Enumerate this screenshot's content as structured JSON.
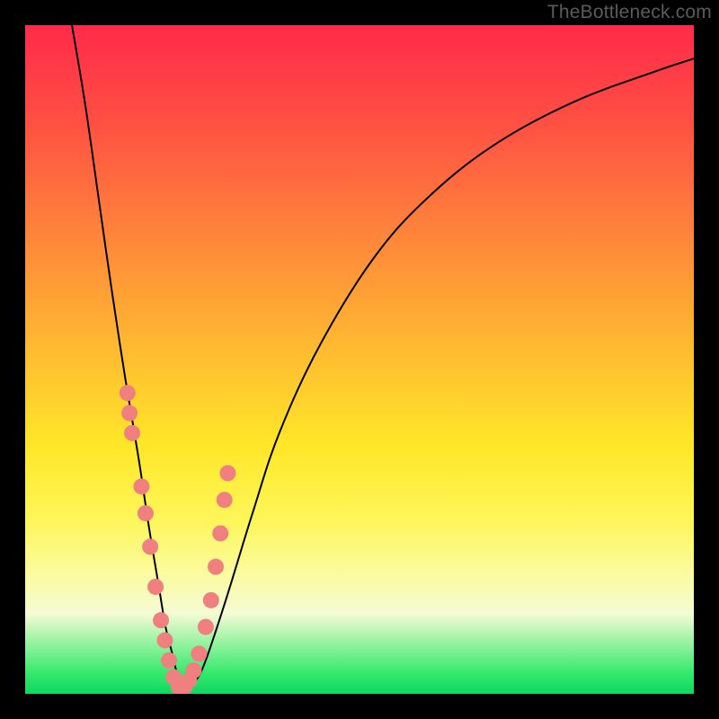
{
  "watermark": "TheBottleneck.com",
  "chart_data": {
    "type": "line",
    "title": "",
    "xlabel": "",
    "ylabel": "",
    "xlim": [
      0,
      100
    ],
    "ylim": [
      0,
      100
    ],
    "grid": false,
    "background_gradient": {
      "top": "#ff2a4a",
      "mid_upper": "#ffa030",
      "mid_lower": "#fde52a",
      "bottom": "#11d760"
    },
    "series": [
      {
        "name": "bottleneck-curve",
        "color": "#000000",
        "x": [
          7,
          9,
          11,
          13,
          15,
          17,
          18.5,
          20,
          21,
          22,
          23,
          24,
          25.5,
          27,
          30,
          34,
          38,
          44,
          52,
          60,
          70,
          82,
          94,
          100
        ],
        "y": [
          100,
          88,
          74,
          60,
          47,
          35,
          25,
          16,
          10,
          6,
          2,
          1,
          2,
          5,
          14,
          27,
          39,
          52,
          65,
          74,
          82,
          88.5,
          93,
          95
        ]
      },
      {
        "name": "highlight-markers",
        "type": "scatter",
        "color": "#f08080",
        "x": [
          15.3,
          15.6,
          16.0,
          17.4,
          18.0,
          18.7,
          19.5,
          20.3,
          20.9,
          21.5,
          22.2,
          23.0,
          23.8,
          24.5,
          25.2,
          26.0,
          27.0,
          27.8,
          28.5,
          29.2,
          29.8,
          30.3
        ],
        "y": [
          45,
          42,
          39,
          31,
          27,
          22,
          16,
          11,
          8,
          5,
          2.5,
          1,
          1,
          2,
          3.5,
          6,
          10,
          14,
          19,
          24,
          29,
          33
        ],
        "marker_radius_px": 9
      }
    ],
    "annotations": []
  }
}
